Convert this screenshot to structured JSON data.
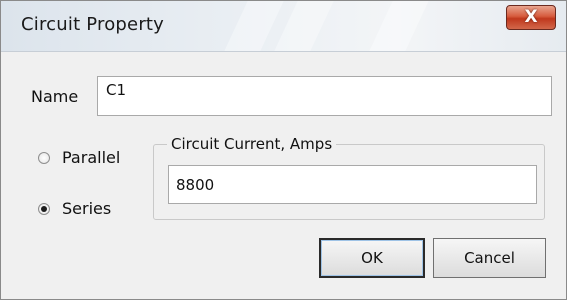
{
  "dialog": {
    "title": "Circuit Property",
    "close_label": "X"
  },
  "name": {
    "label": "Name",
    "value": "C1"
  },
  "connection": {
    "options": [
      {
        "label": "Parallel",
        "checked": false
      },
      {
        "label": "Series",
        "checked": true
      }
    ]
  },
  "current": {
    "group_label": "Circuit Current, Amps",
    "value": "8800"
  },
  "buttons": {
    "ok_label": "OK",
    "cancel_label": "Cancel"
  }
}
